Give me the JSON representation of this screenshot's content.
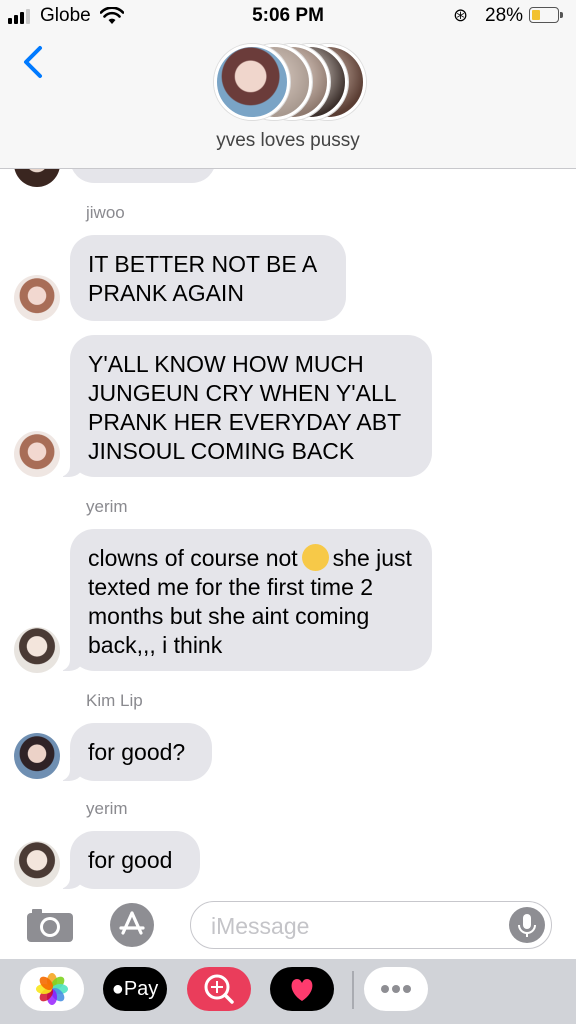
{
  "status_bar": {
    "carrier": "Globe",
    "time": "5:06 PM",
    "battery_percent": "28%",
    "battery_level": 0.28,
    "icons": [
      "signal-icon",
      "wifi-icon",
      "orientation-lock-icon",
      "battery-icon"
    ]
  },
  "header": {
    "back_icon": "chevron-left-icon",
    "group_name": "yves loves pussy"
  },
  "messages": {
    "senders": {
      "jiwoo": "jiwoo",
      "yerim_1": "yerim",
      "kimlip": "Kim Lip",
      "yerim_2": "yerim"
    },
    "bubbles": {
      "jiwoo_1": "IT BETTER NOT BE A PRANK AGAIN",
      "jiwoo_2": "Y'ALL KNOW HOW MUCH JUNGEUN CRY WHEN Y'ALL PRANK HER EVERYDAY ABT JINSOUL COMING BACK",
      "yerim_1a": "clowns of course not",
      "yerim_1b": "she just texted me for the first time 2 months but she aint coming back,,, i think",
      "kimlip_1": "for good?",
      "yerim_2": "for good"
    },
    "emoji": "pensive-face"
  },
  "input_bar": {
    "placeholder": "iMessage",
    "value": "",
    "icons": [
      "camera-icon",
      "app-store-icon",
      "microphone-icon"
    ]
  },
  "app_drawer": {
    "apps": [
      "photos-app-icon",
      "apple-pay-app-icon",
      "search-images-app-icon",
      "digital-touch-app-icon",
      "more-apps-icon"
    ],
    "apple_pay_label": "Pay",
    "colors": {
      "drawer_bg": "#d1d3d8",
      "search_app": "#ea3d5b",
      "touch_app": "#000000"
    }
  },
  "colors": {
    "accent": "#007aff",
    "bubble_gray": "#e5e5ea",
    "sender_gray": "#8a8a8f"
  }
}
